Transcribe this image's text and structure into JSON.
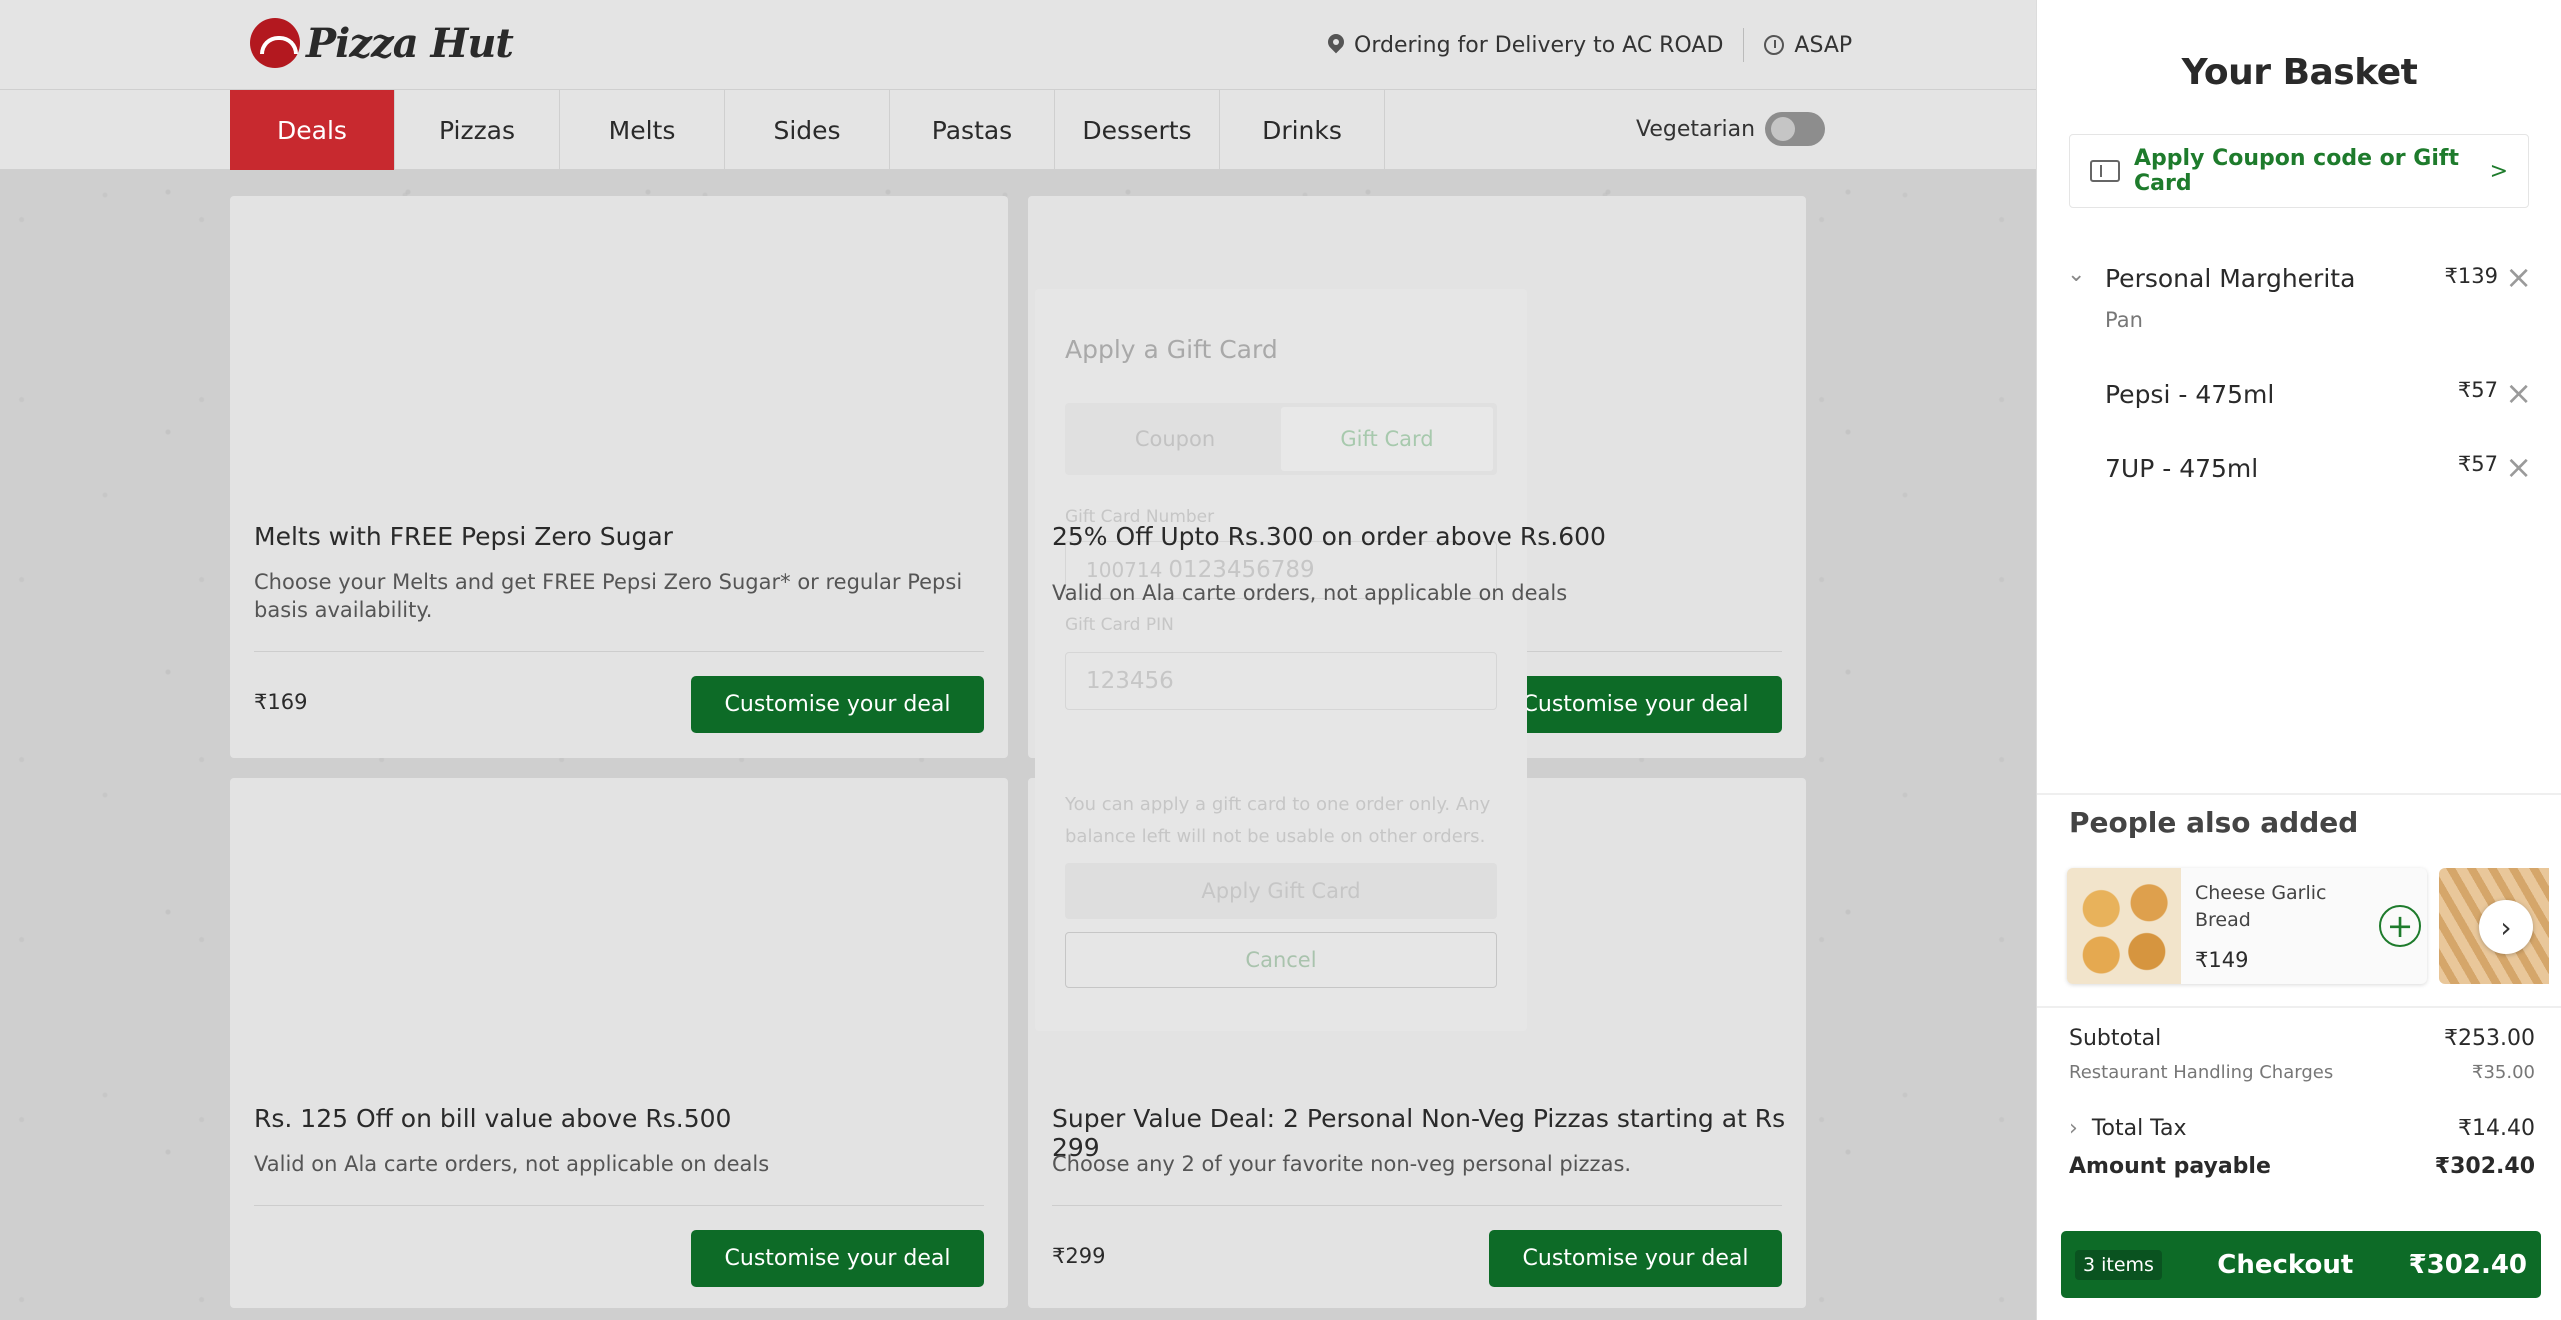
{
  "brand": {
    "logo_text": "Pizza Hut"
  },
  "header": {
    "delivery_text": "Ordering for Delivery to AC ROAD",
    "time_text": "ASAP"
  },
  "nav": {
    "items": [
      "Deals",
      "Pizzas",
      "Melts",
      "Sides",
      "Pastas",
      "Desserts",
      "Drinks"
    ],
    "active": "Deals",
    "veg_label": "Vegetarian",
    "veg_toggle_on": false
  },
  "deals": [
    {
      "title": "Melts with FREE Pepsi Zero Sugar",
      "desc": "Choose your Melts and get FREE Pepsi Zero Sugar* or regular Pepsi basis availability.",
      "price": "₹169",
      "cta": "Customise your deal"
    },
    {
      "title": "25% Off Upto Rs.300 on order above Rs.600",
      "desc": "Valid on Ala carte orders, not applicable on deals",
      "price": "",
      "cta": "Customise your deal"
    },
    {
      "title": "Rs. 125 Off on bill value above Rs.500",
      "desc": "Valid on Ala carte orders, not applicable on deals",
      "price": "",
      "cta": "Customise your deal"
    },
    {
      "title": "Super Value Deal: 2 Personal Non-Veg Pizzas starting at Rs 299",
      "desc": "Choose any 2 of your favorite non-veg personal pizzas.",
      "price": "₹299",
      "cta": "Customise your deal"
    }
  ],
  "modal": {
    "title": "Apply a Gift Card",
    "tabs": [
      "Coupon",
      "Gift Card"
    ],
    "active_tab": "Gift Card",
    "card_number_label": "Gift Card Number",
    "card_number_prefix": "100714",
    "card_number_placeholder": "0123456789",
    "pin_label": "Gift Card PIN",
    "pin_placeholder": "123456",
    "note": "You can apply a gift card to one order only. Any balance left will not be usable on other orders.",
    "apply_label": "Apply Gift Card",
    "cancel_label": "Cancel"
  },
  "basket": {
    "title": "Your Basket",
    "coupon_text": "Apply Coupon code or Gift Card",
    "coupon_arrow": ">",
    "items": [
      {
        "name": "Personal Margherita",
        "sub": "Pan",
        "price": "₹139"
      },
      {
        "name": "Pepsi - 475ml",
        "sub": "",
        "price": "₹57"
      },
      {
        "name": "7UP - 475ml",
        "sub": "",
        "price": "₹57"
      }
    ],
    "people_also_added_title": "People also added",
    "suggestion": {
      "name": "Cheese Garlic Bread",
      "price": "₹149"
    },
    "summary": {
      "subtotal_label": "Subtotal",
      "subtotal": "₹253.00",
      "handling_label": "Restaurant Handling Charges",
      "handling": "₹35.00",
      "tax_label": "Total Tax",
      "tax": "₹14.40",
      "payable_label": "Amount payable",
      "payable": "₹302.40"
    },
    "checkout": {
      "items_badge": "3 items",
      "label": "Checkout",
      "total": "₹302.40"
    }
  }
}
